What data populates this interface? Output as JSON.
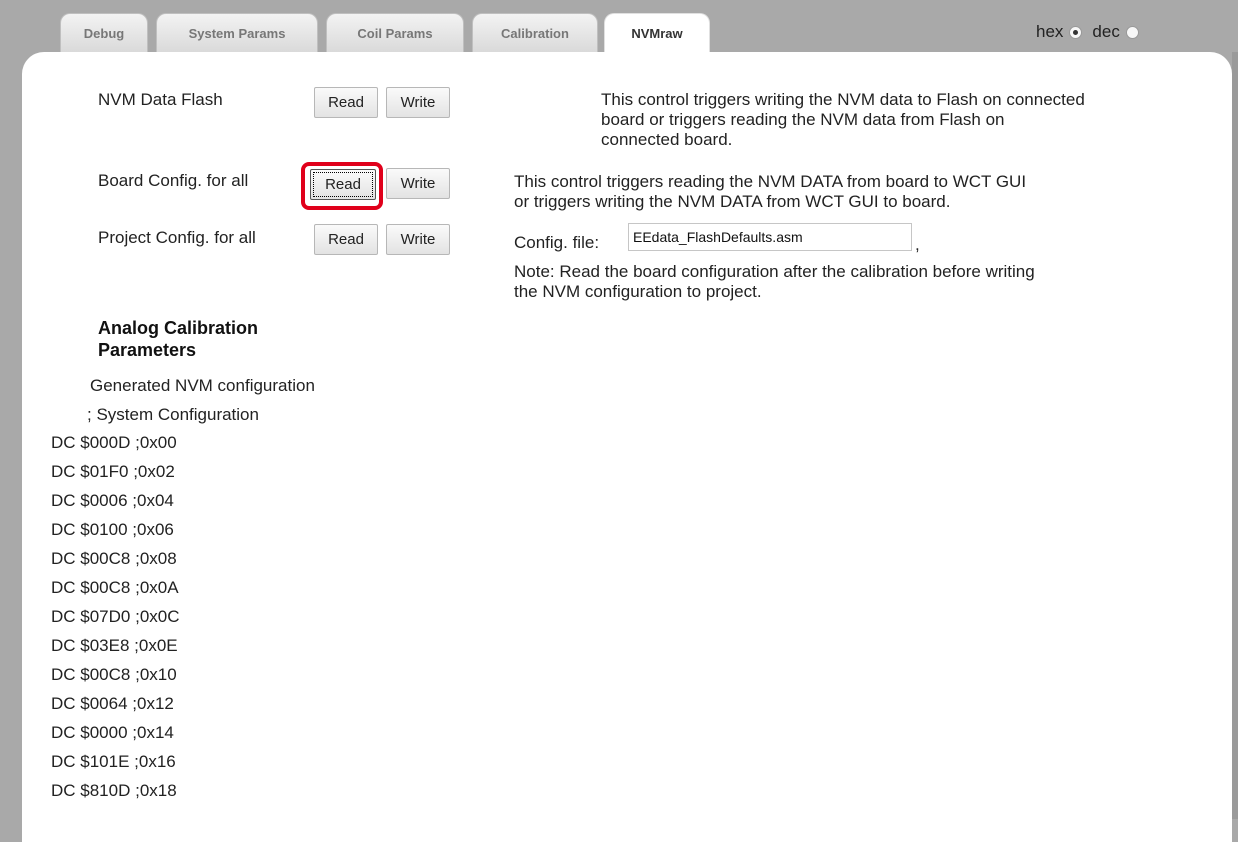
{
  "tabs": [
    {
      "label": "Debug",
      "active": false
    },
    {
      "label": "System Params",
      "active": false
    },
    {
      "label": "Coil Params",
      "active": false
    },
    {
      "label": "Calibration",
      "active": false
    },
    {
      "label": "NVMraw",
      "active": true
    }
  ],
  "format": {
    "hex_label": "hex",
    "dec_label": "dec",
    "selected": "hex"
  },
  "rows": {
    "nvm_flash": {
      "label": "NVM Data Flash",
      "read": "Read",
      "write": "Write"
    },
    "board_config": {
      "label": "Board Config. for all",
      "read": "Read",
      "write": "Write"
    },
    "project_config": {
      "label": "Project Config. for all",
      "read": "Read",
      "write": "Write"
    }
  },
  "descriptions": {
    "flash_line1": "This control triggers writing the NVM data to Flash on connected",
    "flash_line2": "board or triggers reading the NVM data from Flash on",
    "flash_line3": "connected board.",
    "board_line1": "This control triggers reading the NVM DATA from board to WCT GUI",
    "board_line2": "or triggers writing the NVM DATA from WCT GUI to board."
  },
  "config_file": {
    "label": "Config. file:",
    "value": "EEdata_FlashDefaults.asm",
    "suffix": ","
  },
  "note": {
    "line1": "Note: Read the board configuration after the calibration before writing",
    "line2": "the NVM configuration to project."
  },
  "analog": {
    "heading_line1": "Analog Calibration",
    "heading_line2": "Parameters",
    "generated": "Generated NVM configuration",
    "system_config": "; System Configuration"
  },
  "nvm_lines": [
    "DC $000D ;0x00",
    "DC $01F0 ;0x02",
    "DC $0006 ;0x04",
    "DC $0100 ;0x06",
    "DC $00C8 ;0x08",
    "DC $00C8 ;0x0A",
    "DC $07D0 ;0x0C",
    "DC $03E8 ;0x0E",
    "DC $00C8 ;0x10",
    "DC $0064 ;0x12",
    "DC $0000 ;0x14",
    "DC $101E ;0x16",
    "DC $810D ;0x18"
  ]
}
